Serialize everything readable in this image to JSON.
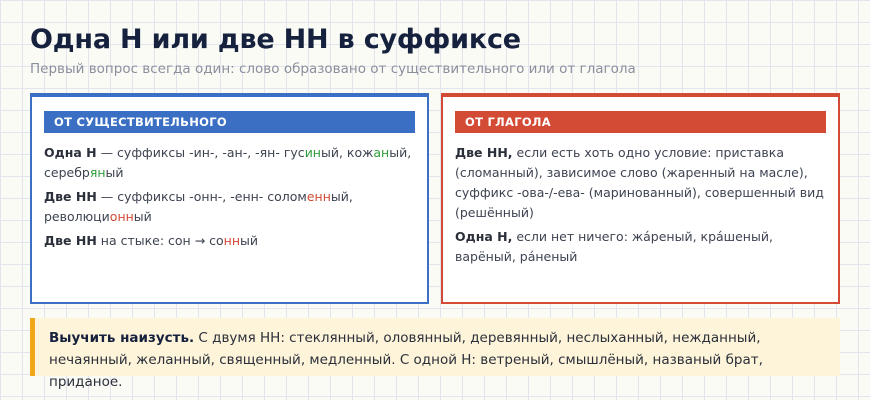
{
  "page": {
    "title": "Одна Н или две НН в суффиксе",
    "subtitle": "Первый вопрос всегда один: слово образовано от существительного или от глагола"
  },
  "left_card": {
    "header": "ОТ СУЩЕСТВИТЕЛЬНОГО",
    "rules": [
      {
        "lead": "Одна Н",
        "text": " — суффиксы -ин-, -ан-, -ян- гус",
        "hl": "ин",
        "text2": "ый, кож",
        "hl2": "ан",
        "text3": "ый, серебр",
        "hl3": "ян",
        "text4": "ый"
      },
      {
        "lead": "Две НН",
        "text": " — суффиксы -онн-, -енн- солом",
        "hl": "енн",
        "text2": "ый, революци",
        "hl2": "онн",
        "text3": "ый"
      },
      {
        "lead": "Две НН",
        "text": " на стыке: сон → со",
        "hl": "нн",
        "text2": "ый"
      }
    ]
  },
  "right_card": {
    "header": "ОТ ГЛАГОЛА",
    "rules": [
      {
        "lead": "Две НН,",
        "text": " если есть хоть одно условие: приставка (сломанный), зависимое слово (жаренный на масле), суффикс -ова-/-ева- (маринованный), совершенный вид (решённый)"
      },
      {
        "lead": "Одна Н,",
        "text": " если нет ничего: жáреный, крáшеный, варёный, рáненый"
      }
    ]
  },
  "note": {
    "lead": "Выучить наизусть.",
    "text": " С двумя НН: стеклянный, оловянный, деревянный, неслыханный, нежданный, нечаянный, желанный, священный, медленный. С одной Н: ветреный, смышлёный, названый брат, приданое."
  },
  "colors": {
    "left_accent": "#3a6fc4",
    "right_accent": "#d34a35",
    "green_highlight": "#2e9d3a",
    "note_bar": "#f0a818"
  }
}
